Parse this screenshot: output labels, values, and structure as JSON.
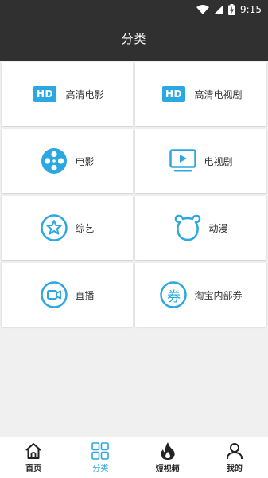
{
  "status": {
    "time": "9:15"
  },
  "header": {
    "title": "分类"
  },
  "categories": [
    {
      "label": "高清电影",
      "icon": "hd-icon",
      "badge": "HD"
    },
    {
      "label": "高清电视剧",
      "icon": "hd-icon",
      "badge": "HD"
    },
    {
      "label": "电影",
      "icon": "film-reel-icon"
    },
    {
      "label": "电视剧",
      "icon": "tv-icon"
    },
    {
      "label": "综艺",
      "icon": "star-circle-icon"
    },
    {
      "label": "动漫",
      "icon": "bear-icon"
    },
    {
      "label": "直播",
      "icon": "video-camera-icon"
    },
    {
      "label": "淘宝内部券",
      "icon": "coupon-icon",
      "badge": "券"
    }
  ],
  "tabbar": {
    "items": [
      {
        "label": "首页",
        "icon": "home-icon"
      },
      {
        "label": "分类",
        "icon": "grid-icon",
        "active": true
      },
      {
        "label": "短视频",
        "icon": "flame-icon"
      },
      {
        "label": "我的",
        "icon": "user-icon"
      }
    ]
  },
  "colors": {
    "accent": "#2ba7e2",
    "header_bg": "#303030",
    "page_bg": "#f0f0f0"
  }
}
